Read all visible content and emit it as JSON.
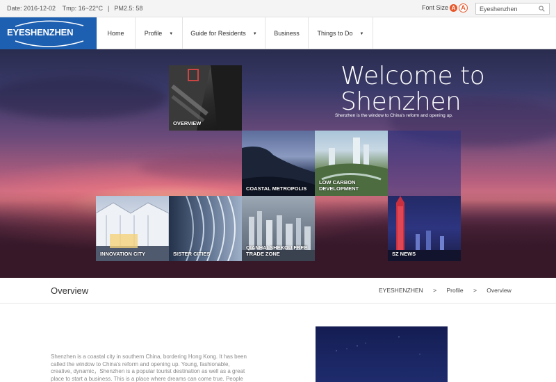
{
  "topbar": {
    "date": "Date: 2016-12-02",
    "tmp": "Tmp: 16~22°C",
    "divider": "|",
    "pm": "PM2.5: 58",
    "font_size_label": "Font Size",
    "font_small": "A",
    "font_large": "A",
    "search_value": "Eyeshenzhen",
    "search_icon": "search-icon"
  },
  "nav": {
    "logo": "EYESHENZHEN",
    "items": [
      {
        "label": "Home",
        "caret": ""
      },
      {
        "label": "Profile",
        "caret": "▼"
      },
      {
        "label": "Guide for Residents",
        "caret": "▼"
      },
      {
        "label": "Business",
        "caret": ""
      },
      {
        "label": "Things to Do",
        "caret": "▼"
      }
    ]
  },
  "hero": {
    "title_line1": "Welcome to",
    "title_line2": "Shenzhen",
    "subtitle": "Shenzhen is the window to China's reform and opening up.",
    "tiles": [
      {
        "label": "OVERVIEW"
      },
      {
        "label": "COASTAL METROPOLIS"
      },
      {
        "label": "LOW CARBON DEVELOPMENT"
      },
      {
        "label": ""
      },
      {
        "label": "INNOVATION CITY"
      },
      {
        "label": "SISTER CITIES"
      },
      {
        "label": "QIANHAI-SHEKOU FREE TRADE ZONE"
      },
      {
        "label": "SZ NEWS"
      }
    ]
  },
  "overview": {
    "title": "Overview",
    "breadcrumb": [
      "EYESHENZHEN",
      ">",
      "Profile",
      ">",
      "Overview"
    ]
  },
  "content": {
    "intro": "Shenzhen is a coastal city in southern China, bordering Hong Kong. It has been called the window to China's reform and opening up. Young, fashionable, creative, dynamic，Shenzhen is a popular tourist destination as well as a great place to start a business. This is a place where dreams can come true. People"
  }
}
